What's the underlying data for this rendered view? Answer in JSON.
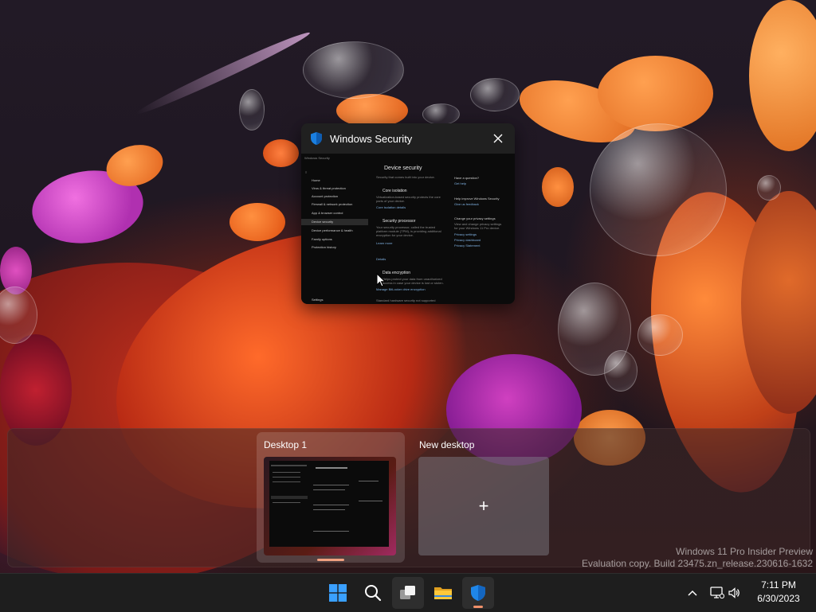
{
  "window": {
    "title": "Windows Security",
    "app_icon": "shield-icon",
    "preview": {
      "app_label": "Windows Security",
      "nav_items": [
        "Home",
        "Virus & threat protection",
        "Account protection",
        "Firewall & network protection",
        "App & browser control",
        "Device security",
        "Device performance & health",
        "Family options",
        "Protection history"
      ],
      "active_nav_index": 5,
      "settings_label": "Settings",
      "page_title": "Device security",
      "page_subtitle": "Security that comes built into your device.",
      "sections": [
        {
          "title": "Core isolation",
          "lines": [
            "Virtualization-based security protects the core",
            "parts of your device."
          ],
          "link": "Core isolation details"
        },
        {
          "title": "Security processor",
          "lines": [
            "Your security processor, called the trusted",
            "platform module (TPM), is providing additional",
            "encryption for your device.",
            "Learn more"
          ],
          "link": "Details"
        },
        {
          "title": "Data encryption",
          "lines": [
            "Helps protect your data from unauthorized",
            "access in case your device is lost or stolen."
          ],
          "link": "Manage BitLocker drive encryption"
        }
      ],
      "footer_line": "Standard hardware security not supported",
      "side": [
        {
          "heading": "Have a question?",
          "links": [
            "Get help"
          ]
        },
        {
          "heading": "Help improve Windows Security",
          "links": [
            "Give us feedback"
          ]
        },
        {
          "heading": "Change your privacy settings",
          "lines": [
            "View and change privacy settings",
            "for your Windows 11 Pro device."
          ],
          "links": [
            "Privacy settings",
            "Privacy dashboard",
            "Privacy Statement"
          ]
        }
      ]
    }
  },
  "desktops": {
    "current": {
      "label": "Desktop 1"
    },
    "new": {
      "label": "New desktop",
      "icon": "plus-icon"
    }
  },
  "watermark": {
    "line1": "Windows 11 Pro Insider Preview",
    "line2": "Evaluation copy. Build 23475.zn_release.230616-1632"
  },
  "taskbar": {
    "apps": [
      {
        "name": "start",
        "icon": "windows-logo-icon"
      },
      {
        "name": "search",
        "icon": "search-icon"
      },
      {
        "name": "task-view",
        "icon": "task-view-icon"
      },
      {
        "name": "file-explorer",
        "icon": "folder-icon"
      },
      {
        "name": "windows-security",
        "icon": "shield-icon"
      }
    ],
    "tray": {
      "chevron": "chevron-up-icon",
      "network": "network-icon",
      "volume": "speaker-icon"
    },
    "clock": {
      "time": "7:11 PM",
      "date": "6/30/2023"
    }
  },
  "colors": {
    "accent": "#0078d4",
    "indicator": "#f0906a",
    "taskbar": "#1e1e1e"
  }
}
